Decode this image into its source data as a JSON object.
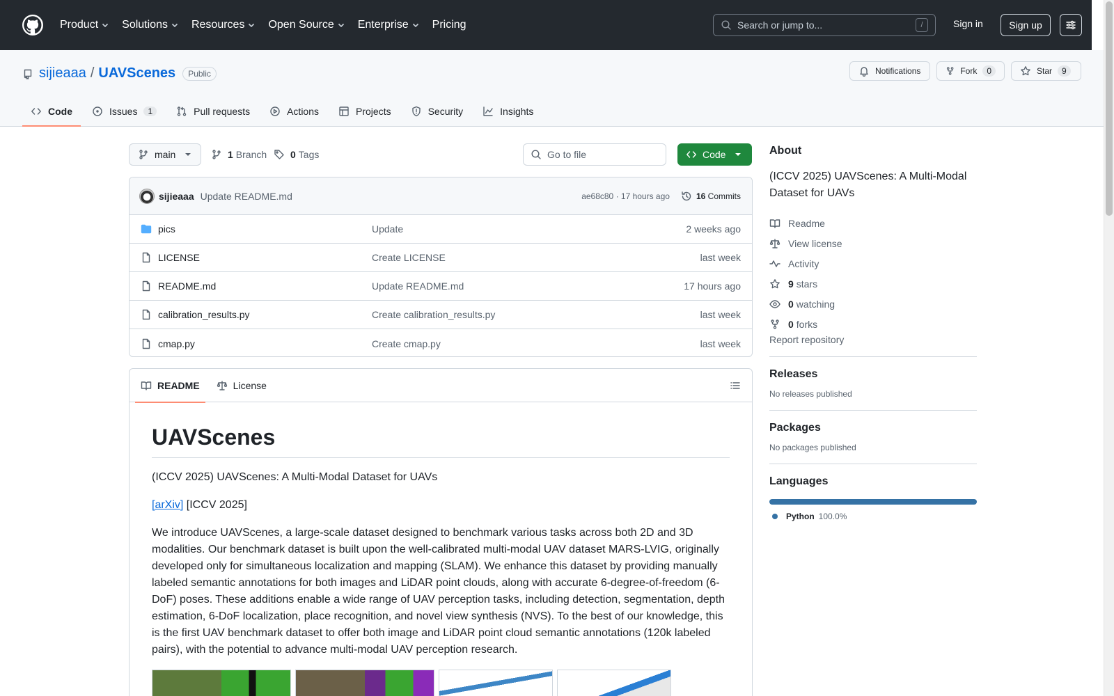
{
  "header": {
    "nav": [
      "Product",
      "Solutions",
      "Resources",
      "Open Source",
      "Enterprise",
      "Pricing"
    ],
    "search_placeholder": "Search or jump to...",
    "slash_key": "/",
    "signin": "Sign in",
    "signup": "Sign up"
  },
  "repo": {
    "owner": "sijieaaa",
    "separator": "/",
    "name": "UAVScenes",
    "visibility": "Public",
    "notifications": "Notifications",
    "fork_label": "Fork",
    "fork_count": "0",
    "star_label": "Star",
    "star_count": "9",
    "tabs": [
      {
        "label": "Code"
      },
      {
        "label": "Issues",
        "count": "1"
      },
      {
        "label": "Pull requests"
      },
      {
        "label": "Actions"
      },
      {
        "label": "Projects"
      },
      {
        "label": "Security"
      },
      {
        "label": "Insights"
      }
    ]
  },
  "toolbar": {
    "branch": "main",
    "branch_count": "1",
    "branch_label": "Branch",
    "tag_count": "0",
    "tag_label": "Tags",
    "goto_placeholder": "Go to file",
    "code_button": "Code"
  },
  "commit": {
    "author": "sijieaaa",
    "message": "Update README.md",
    "hash_time": "ae68c80 · 17 hours ago",
    "count": "16",
    "count_label": "Commits"
  },
  "files": [
    {
      "name": "pics",
      "type": "folder",
      "message": "Update",
      "date": "2 weeks ago"
    },
    {
      "name": "LICENSE",
      "type": "file",
      "message": "Create LICENSE",
      "date": "last week"
    },
    {
      "name": "README.md",
      "type": "file",
      "message": "Update README.md",
      "date": "17 hours ago"
    },
    {
      "name": "calibration_results.py",
      "type": "file",
      "message": "Create calibration_results.py",
      "date": "last week"
    },
    {
      "name": "cmap.py",
      "type": "file",
      "message": "Create cmap.py",
      "date": "last week"
    }
  ],
  "readme": {
    "tab_readme": "README",
    "tab_license": "License",
    "title": "UAVScenes",
    "subtitle": "(ICCV 2025) UAVScenes: A Multi-Modal Dataset for UAVs",
    "arxiv": "[arXiv]",
    "iccv": " [ICCV 2025]",
    "intro": "We introduce UAVScenes, a large-scale dataset designed to benchmark various tasks across both 2D and 3D modalities. Our benchmark dataset is built upon the well-calibrated multi-modal UAV dataset MARS-LVIG, originally developed only for simultaneous localization and mapping (SLAM). We enhance this dataset by providing manually labeled semantic annotations for both images and LiDAR point clouds, along with accurate 6-degree-of-freedom (6-DoF) poses. These additions enable a wide range of UAV perception tasks, including detection, segmentation, depth estimation, 6-DoF localization, place recognition, and novel view synthesis (NVS). To the best of our knowledge, this is the first UAV benchmark dataset to offer both image and LiDAR point cloud semantic annotations (120k labeled pairs), with the potential to advance multi-modal UAV perception research."
  },
  "about": {
    "title": "About",
    "description": "(ICCV 2025) UAVScenes: A Multi-Modal Dataset for UAVs",
    "readme": "Readme",
    "license": "View license",
    "activity": "Activity",
    "stars_count": "9",
    "stars_label": "stars",
    "watching_count": "0",
    "watching_label": "watching",
    "forks_count": "0",
    "forks_label": "forks",
    "report": "Report repository"
  },
  "releases": {
    "title": "Releases",
    "text": "No releases published"
  },
  "packages": {
    "title": "Packages",
    "text": "No packages published"
  },
  "languages": {
    "title": "Languages",
    "name": "Python",
    "percent": "100.0%",
    "color": "#3572a5"
  }
}
